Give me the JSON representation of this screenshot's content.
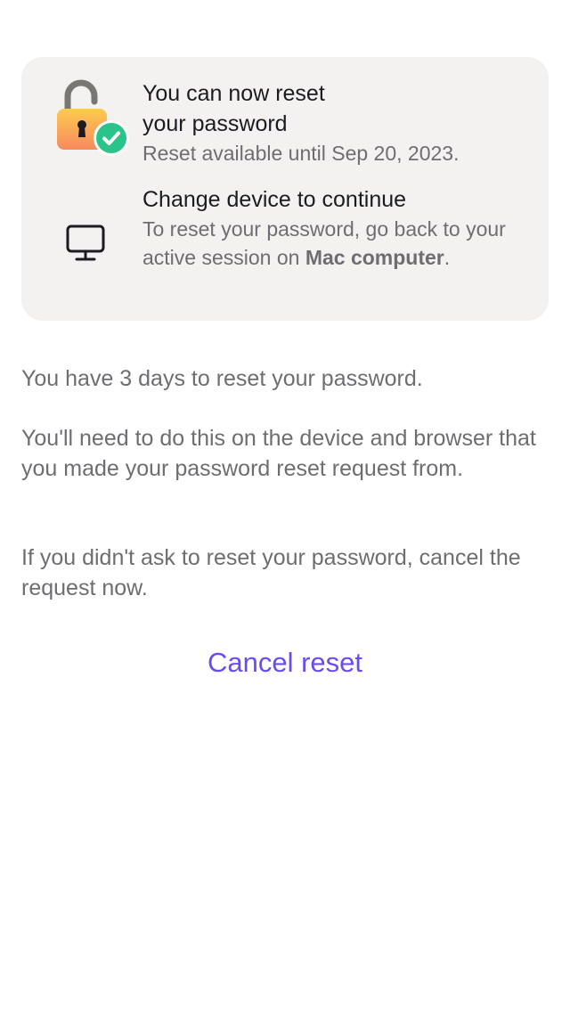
{
  "card": {
    "reset_title_line1": "You can now reset",
    "reset_title_line2": "your password",
    "reset_subtitle": "Reset available until Sep 20, 2023.",
    "device_title": "Change device to continue",
    "device_desc_prefix": "To reset your password, go back to your active session on ",
    "device_name": "Mac computer",
    "device_desc_suffix": ".",
    "icons": {
      "lock": "unlocked-padlock-icon",
      "check": "check-badge-icon",
      "monitor": "desktop-monitor-icon"
    }
  },
  "body": {
    "paragraph1": "You have 3 days to reset your password.",
    "paragraph2": "You'll need to do this on the device and browser that you made your password reset request from.",
    "paragraph3": "If you didn't ask to reset your password, cancel the request now."
  },
  "actions": {
    "cancel_label": "Cancel reset"
  },
  "colors": {
    "card_bg": "#f3f2f1",
    "accent": "#6a4cf5",
    "check_green": "#2ac48a",
    "lock_gold": "#fbbf4a"
  }
}
